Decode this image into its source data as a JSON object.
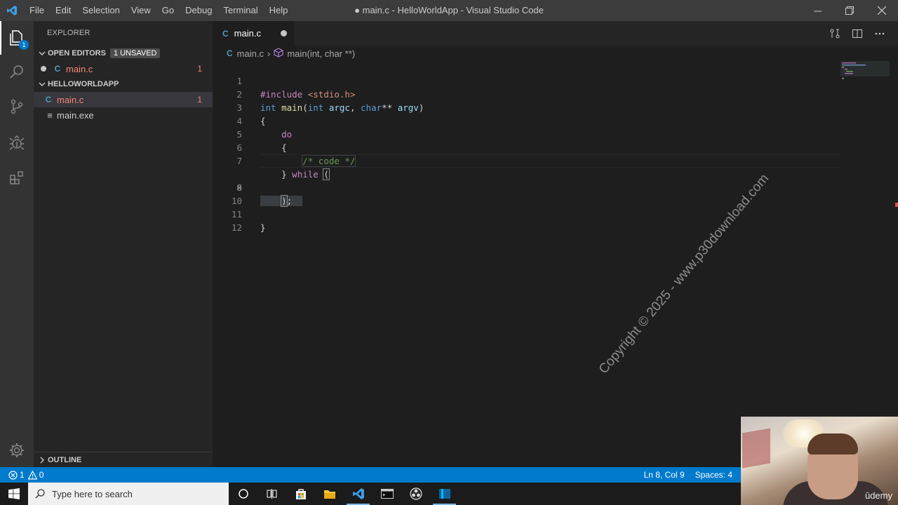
{
  "window": {
    "title": "● main.c - HelloWorldApp - Visual Studio Code",
    "menu": [
      "File",
      "Edit",
      "Selection",
      "View",
      "Go",
      "Debug",
      "Terminal",
      "Help"
    ]
  },
  "activity_bar": {
    "explorer_badge": "1",
    "icons": [
      "files-icon",
      "search-icon",
      "source-control-icon",
      "debug-icon",
      "extensions-icon",
      "settings-gear-icon"
    ]
  },
  "sidebar": {
    "title": "EXPLORER",
    "open_editors": {
      "label": "OPEN EDITORS",
      "badge": "1 UNSAVED",
      "items": [
        {
          "icon": "C",
          "name": "main.c",
          "problems": "1"
        }
      ]
    },
    "folder": {
      "label": "HELLOWORLDAPP",
      "items": [
        {
          "icon": "C",
          "name": "main.c",
          "problems": "1"
        },
        {
          "icon": "≡",
          "name": "main.exe",
          "problems": ""
        }
      ]
    },
    "outline_label": "OUTLINE"
  },
  "editor": {
    "tab": {
      "icon": "C",
      "label": "main.c"
    },
    "breadcrumb": {
      "file_icon": "C",
      "file": "main.c",
      "symbol": "main(int, char **)"
    },
    "lines": [
      "1",
      "2",
      "3",
      "4",
      "5",
      "6",
      "7",
      "8",
      "9",
      "10",
      "11",
      "12"
    ],
    "code": {
      "l1_directive": "#include",
      "l1_header": "<stdio.h>",
      "l2_int": "int",
      "l2_main": "main",
      "l2_open": "(",
      "l2_int2": "int",
      "l2_argc": "argc",
      "l2_comma": ", ",
      "l2_char": "char",
      "l2_stars": "**",
      "l2_argv": "argv",
      "l2_close": ")",
      "l3": "{",
      "l4_do": "do",
      "l5": "{",
      "l6_comment": "/* code */",
      "l7_brace": "}",
      "l7_while": "while",
      "l7_paren": "(",
      "l9_paren": ")",
      "l9_semi": ";",
      "l11": "}"
    }
  },
  "watermark": "Copyright © 2025 - www.p30download.com",
  "status_bar": {
    "errors": "1",
    "warnings": "0",
    "position": "Ln 8, Col 9",
    "spaces": "Spaces: 4"
  },
  "taskbar": {
    "search_placeholder": "Type here to search",
    "apps": [
      "cortana-icon",
      "task-view-icon",
      "store-icon",
      "file-explorer-icon",
      "vscode-icon",
      "terminal-icon",
      "obs-icon",
      "app-icon"
    ]
  },
  "webcam": {
    "brand": "ūdemy"
  },
  "colors": {
    "accent": "#007acc",
    "titlebar": "#3c3c3c",
    "sidebar": "#252526",
    "editor": "#1e1e1e",
    "error": "#f48771"
  }
}
